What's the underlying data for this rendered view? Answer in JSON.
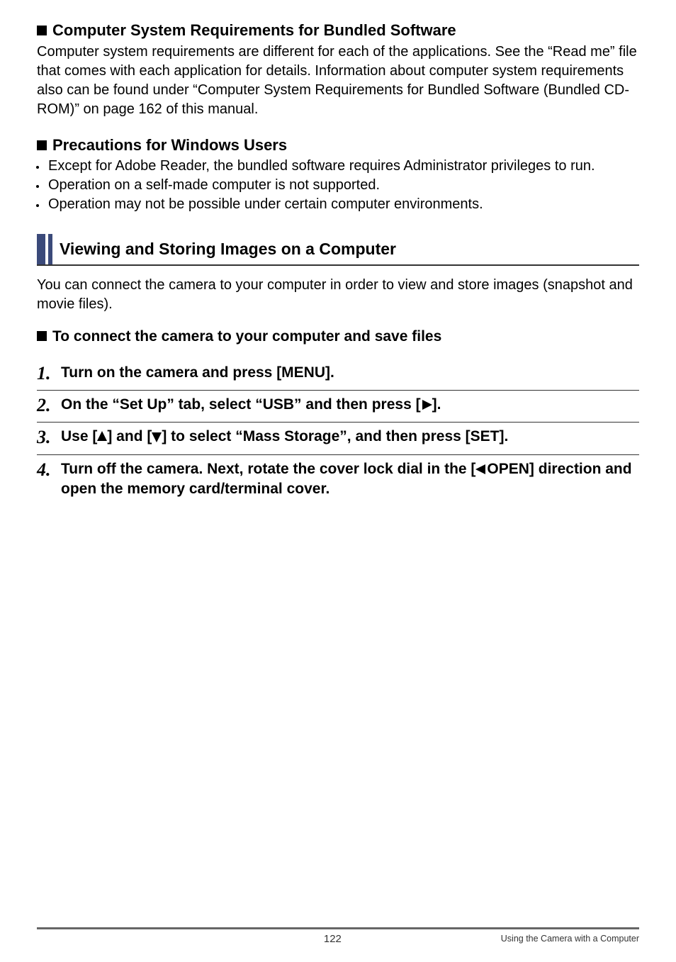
{
  "section1": {
    "title": "Computer System Requirements for Bundled Software",
    "text": "Computer system requirements are different for each of the applications. See the “Read me” file that comes with each application for details. Information about computer system requirements also can be found under “Computer System Requirements for Bundled Software (Bundled CD-ROM)” on page 162 of this manual."
  },
  "section2": {
    "title": "Precautions for Windows Users",
    "bullets": [
      "Except for Adobe Reader, the bundled software requires Administrator privileges to run.",
      "Operation on a self-made computer is not supported.",
      "Operation may not be possible under certain computer environments."
    ]
  },
  "subhead": "Viewing and Storing Images on a Computer",
  "intro": "You can connect the camera to your computer in order to view and store images (snapshot and movie files).",
  "section3": {
    "title": "To connect the camera to your computer and save files"
  },
  "steps": [
    {
      "num": "1.",
      "text": "Turn on the camera and press [MENU]."
    },
    {
      "num": "2.",
      "pre": "On the “Set Up” tab, select “USB” and then press [",
      "arrow": "right",
      "post": "]."
    },
    {
      "num": "3.",
      "pre": "Use [",
      "arrow1": "up",
      "mid": "] and [",
      "arrow2": "down",
      "post": "] to select “Mass Storage”, and then press [SET]."
    },
    {
      "num": "4.",
      "pre": "Turn off the camera. Next, rotate the cover lock dial in the [",
      "arrow": "left",
      "post": "OPEN] direction and open the memory card/terminal cover."
    }
  ],
  "footer": {
    "page": "122",
    "text": "Using the Camera with a Computer"
  },
  "icons": {
    "square": "square-icon",
    "arrow_right": "arrow-right-icon",
    "arrow_left": "arrow-left-icon",
    "arrow_up": "arrow-up-icon",
    "arrow_down": "arrow-down-icon"
  }
}
